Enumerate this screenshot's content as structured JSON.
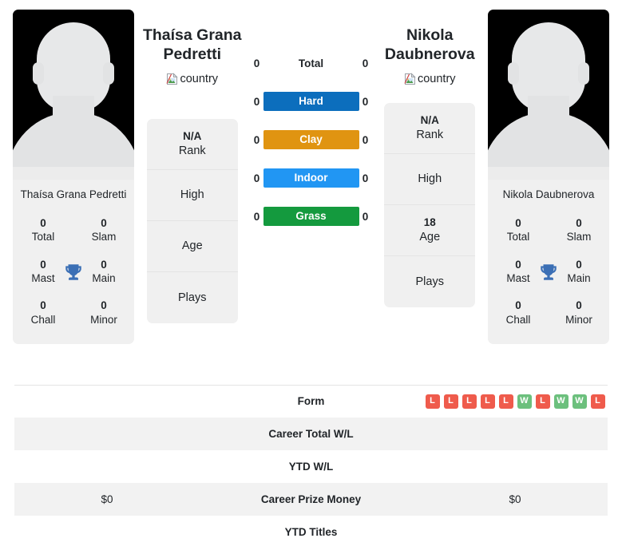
{
  "players": {
    "left": {
      "name": "Thaísa Grana Pedretti",
      "card_name": "Thaísa Grana Pedretti",
      "flag_alt": "country",
      "titles": [
        {
          "value": "0",
          "label": "Total"
        },
        {
          "value": "0",
          "label": "Slam"
        },
        {
          "value": "0",
          "label": "Mast"
        },
        {
          "value": "0",
          "label": "Main"
        },
        {
          "value": "0",
          "label": "Chall"
        },
        {
          "value": "0",
          "label": "Minor"
        }
      ],
      "info": [
        {
          "value": "N/A",
          "label": "Rank"
        },
        {
          "value": "",
          "label": "High"
        },
        {
          "value": "",
          "label": "Age"
        },
        {
          "value": "",
          "label": "Plays"
        }
      ]
    },
    "right": {
      "name": "Nikola Daubnerova",
      "card_name": "Nikola Daubnerova",
      "flag_alt": "country",
      "titles": [
        {
          "value": "0",
          "label": "Total"
        },
        {
          "value": "0",
          "label": "Slam"
        },
        {
          "value": "0",
          "label": "Mast"
        },
        {
          "value": "0",
          "label": "Main"
        },
        {
          "value": "0",
          "label": "Chall"
        },
        {
          "value": "0",
          "label": "Minor"
        }
      ],
      "info": [
        {
          "value": "N/A",
          "label": "Rank"
        },
        {
          "value": "",
          "label": "High"
        },
        {
          "value": "18",
          "label": "Age"
        },
        {
          "value": "",
          "label": "Plays"
        }
      ]
    }
  },
  "head_to_head": [
    {
      "label": "Total",
      "left": "0",
      "right": "0",
      "badge": false,
      "color": ""
    },
    {
      "label": "Hard",
      "left": "0",
      "right": "0",
      "badge": true,
      "color": "#0c6ebd"
    },
    {
      "label": "Clay",
      "left": "0",
      "right": "0",
      "badge": true,
      "color": "#e09411"
    },
    {
      "label": "Indoor",
      "left": "0",
      "right": "0",
      "badge": true,
      "color": "#2196f3"
    },
    {
      "label": "Grass",
      "left": "0",
      "right": "0",
      "badge": true,
      "color": "#149a3e"
    }
  ],
  "table_rows": [
    {
      "label": "Form",
      "left": "",
      "right": "",
      "striped": false,
      "topline": true,
      "form": [
        "L",
        "L",
        "L",
        "L",
        "L",
        "W",
        "L",
        "W",
        "W",
        "L"
      ]
    },
    {
      "label": "Career Total W/L",
      "left": "",
      "right": "",
      "striped": true,
      "topline": false,
      "form": []
    },
    {
      "label": "YTD W/L",
      "left": "",
      "right": "",
      "striped": false,
      "topline": false,
      "form": []
    },
    {
      "label": "Career Prize Money",
      "left": "$0",
      "right": "$0",
      "striped": true,
      "topline": false,
      "form": []
    },
    {
      "label": "YTD Titles",
      "left": "",
      "right": "",
      "striped": false,
      "topline": false,
      "form": []
    }
  ],
  "colors": {
    "win": "#6cc07d",
    "loss": "#ef5b4c",
    "trophy": "#3b6fb5",
    "panel_bg": "#f0f0f0",
    "stripe": "#f2f2f2"
  }
}
